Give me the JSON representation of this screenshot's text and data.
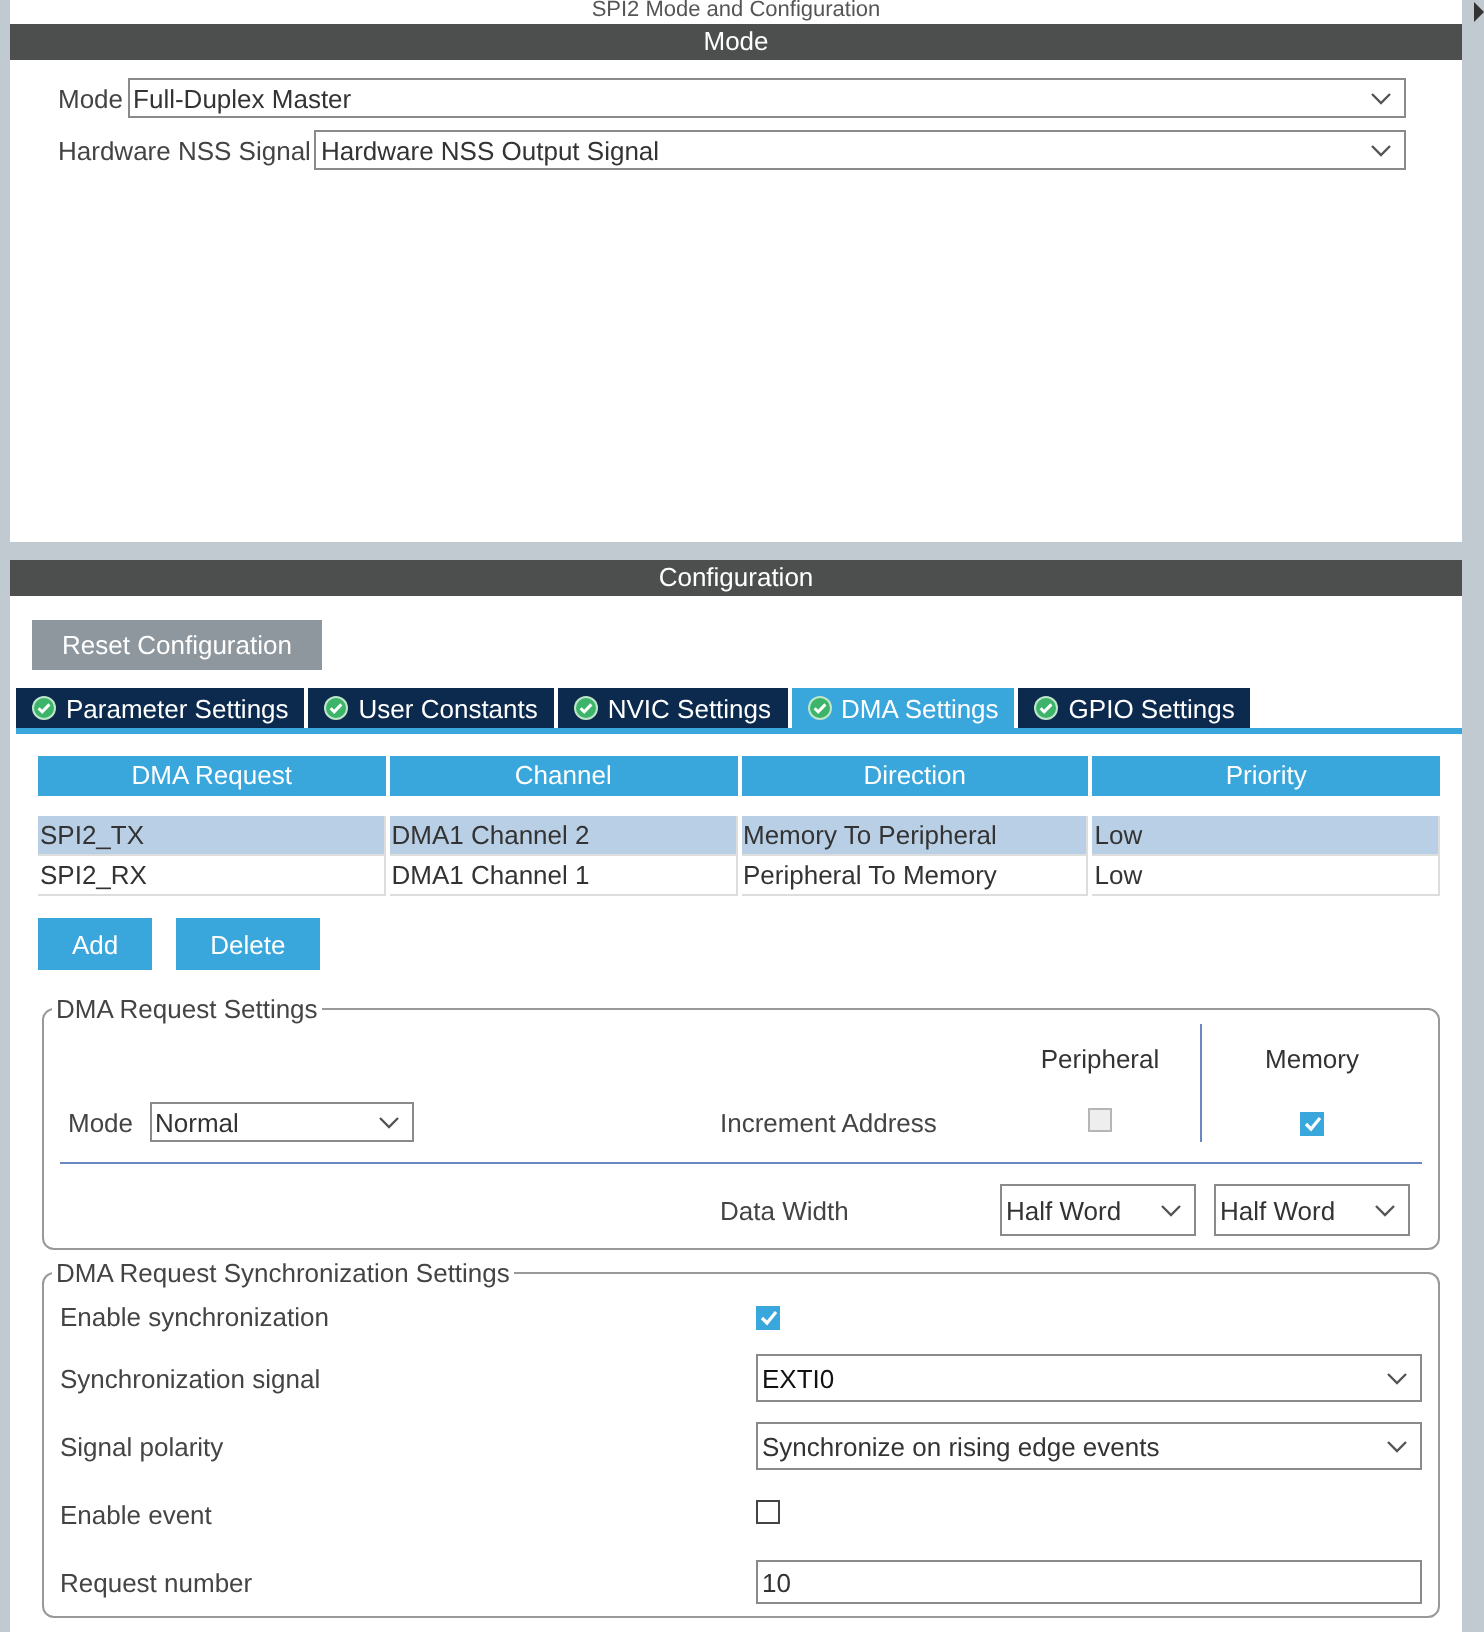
{
  "header": {
    "title": "SPI2 Mode and Configuration"
  },
  "mode": {
    "title": "Mode",
    "fields": [
      {
        "label": "Mode",
        "value": "Full-Duplex Master"
      },
      {
        "label": "Hardware NSS Signal",
        "value": "Hardware NSS Output Signal"
      }
    ]
  },
  "configuration": {
    "title": "Configuration",
    "reset_button": "Reset Configuration",
    "tabs": [
      {
        "label": "Parameter Settings",
        "selected": false
      },
      {
        "label": "User Constants",
        "selected": false
      },
      {
        "label": "NVIC Settings",
        "selected": false
      },
      {
        "label": "DMA Settings",
        "selected": true
      },
      {
        "label": "GPIO Settings",
        "selected": false
      }
    ],
    "dma_table": {
      "columns": [
        "DMA Request",
        "Channel",
        "Direction",
        "Priority"
      ],
      "rows": [
        {
          "cells": [
            "SPI2_TX",
            "DMA1 Channel 2",
            "Memory To Peripheral",
            "Low"
          ],
          "selected": true
        },
        {
          "cells": [
            "SPI2_RX",
            "DMA1 Channel 1",
            "Peripheral To Memory",
            "Low"
          ],
          "selected": false
        }
      ]
    },
    "buttons": [
      "Add",
      "Delete"
    ],
    "request_settings": {
      "title": "DMA Request Settings",
      "mode_label": "Mode",
      "mode_value": "Normal",
      "columns": [
        "Peripheral",
        "Memory"
      ],
      "increment_label": "Increment Address",
      "increment": [
        {
          "checked": false,
          "disabled": true
        },
        {
          "checked": true,
          "disabled": false
        }
      ],
      "data_width_label": "Data Width",
      "data_width": [
        "Half Word",
        "Half Word"
      ]
    },
    "sync_settings": {
      "title": "DMA Request Synchronization Settings",
      "rows": [
        {
          "kind": "checkbox",
          "label": "Enable synchronization",
          "checked": true
        },
        {
          "kind": "select",
          "label": "Synchronization signal",
          "value": "EXTI0"
        },
        {
          "kind": "select",
          "label": "Signal polarity",
          "value": "Synchronize on rising edge events"
        },
        {
          "kind": "checkbox",
          "label": "Enable event",
          "checked": false
        },
        {
          "kind": "input",
          "label": "Request number",
          "value": "10"
        }
      ]
    }
  }
}
